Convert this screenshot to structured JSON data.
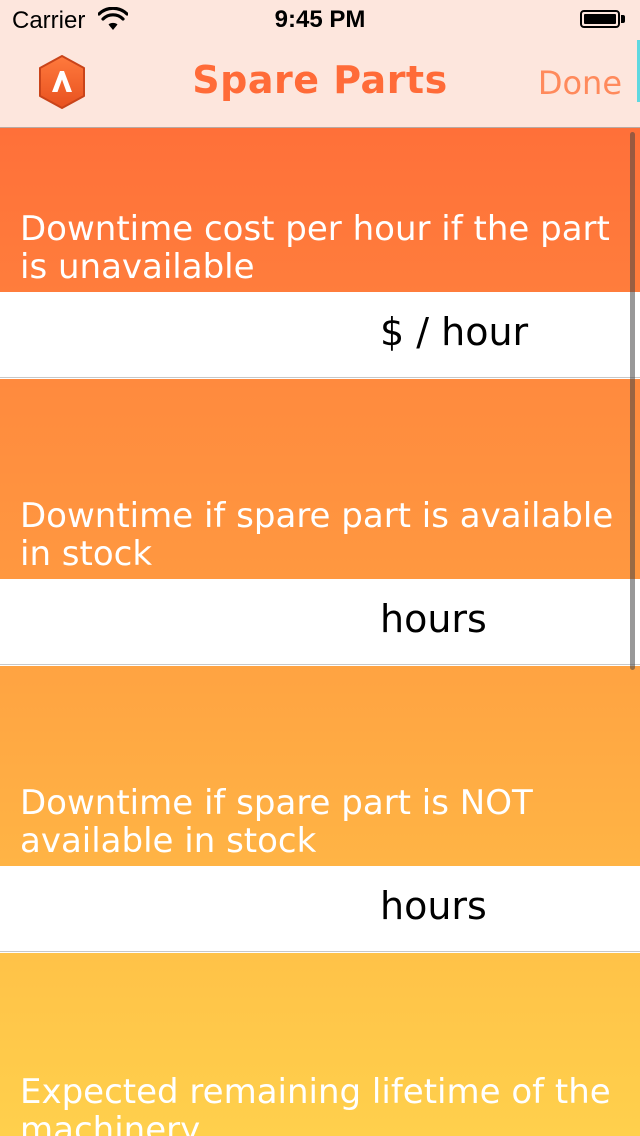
{
  "status_bar": {
    "carrier": "Carrier",
    "time": "9:45 PM"
  },
  "nav": {
    "title": "Spare Parts",
    "done_label": "Done",
    "logo_icon": "app-logo-a-icon"
  },
  "colors": {
    "nav_background": "#fde6dd",
    "title": "#ff6b38",
    "done": "#ff8a5c"
  },
  "fields": [
    {
      "label": "Downtime cost per hour if the part is unavailable",
      "unit": "$ / hour",
      "value": ""
    },
    {
      "label": "Downtime if spare part is available in stock",
      "unit": "hours",
      "value": ""
    },
    {
      "label": "Downtime if spare part is NOT available in stock",
      "unit": "hours",
      "value": ""
    },
    {
      "label": "Expected remaining lifetime of the machinery",
      "unit": "",
      "value": ""
    }
  ]
}
